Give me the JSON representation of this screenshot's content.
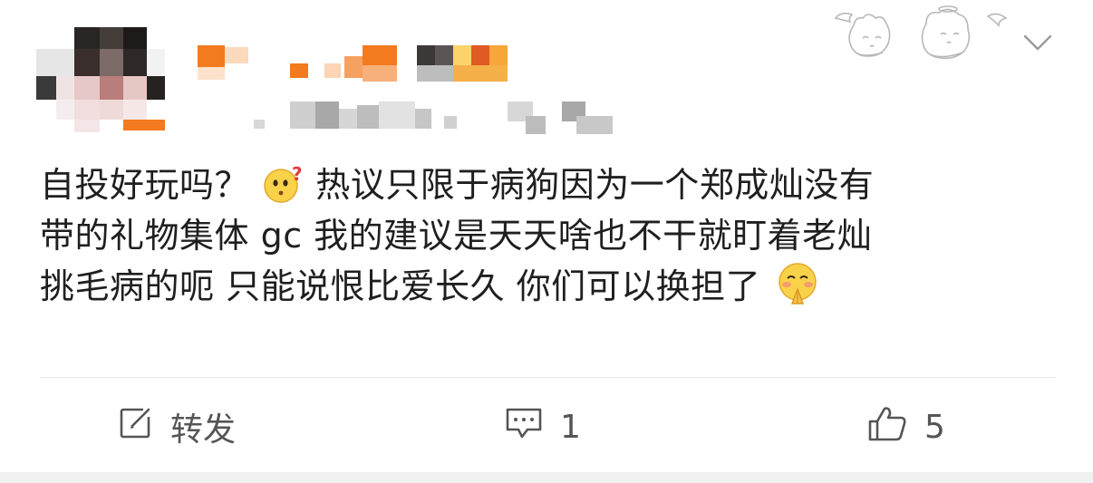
{
  "post": {
    "content_lines": [
      {
        "before": "自投好玩吗？",
        "emoji": "thinking-question-emoji",
        "after": "热议只限于病狗因为一个郑成灿没有"
      },
      {
        "before": "带的礼物集体 gc 我的建议是天天啥也不干就盯着老灿",
        "emoji": "",
        "after": ""
      },
      {
        "before": "挑毛病的呃 只能说恨比爱长久 你们可以换担了",
        "emoji": "blushing-pray-emoji",
        "after": ""
      }
    ]
  },
  "actions": {
    "repost_label": "转发",
    "comment_count": "1",
    "like_count": "5"
  },
  "icons": {
    "repost": "edit-square-icon",
    "comment": "comment-bubble-icon",
    "like": "thumbs-up-icon",
    "more": "chevron-down-icon",
    "badge": "angel-cats-badge"
  },
  "colors": {
    "text": "#1f1f1f",
    "muted": "#555555",
    "divider": "#e6e6e6",
    "name_accent": "#f37a1f"
  }
}
